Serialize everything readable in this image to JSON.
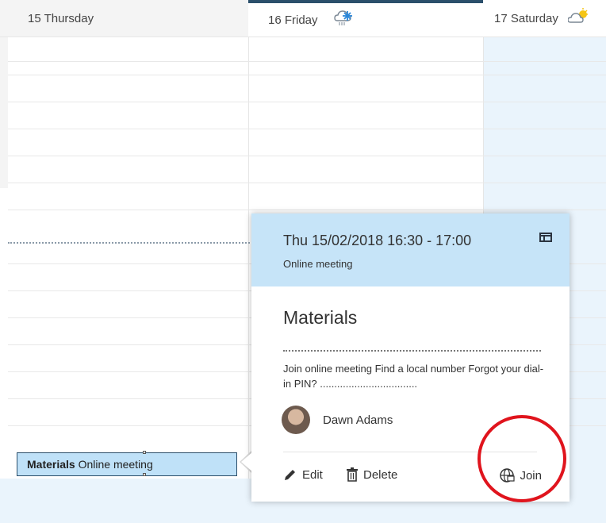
{
  "header": {
    "days": [
      {
        "label": "15 Thursday"
      },
      {
        "label": "16 Friday",
        "weather": "snow-cloud-icon"
      },
      {
        "label": "17 Saturday",
        "weather": "partly-sunny-icon"
      }
    ]
  },
  "event": {
    "title": "Materials",
    "subtitle": "Online meeting"
  },
  "popup": {
    "time": "Thu 15/02/2018 16:30 - 17:00",
    "type": "Online meeting",
    "title": "Materials",
    "body": "Join online meeting Find a local number Forgot your dial-in PIN? ..................................",
    "person": "Dawn Adams",
    "actions": {
      "edit": "Edit",
      "delete": "Delete",
      "join": "Join"
    }
  },
  "colors": {
    "accent": "#2b4f6b",
    "event_fill": "#bfe1f8",
    "popup_header": "#c6e4f8",
    "weekend": "#eaf4fc",
    "annotation": "#e0141d"
  }
}
